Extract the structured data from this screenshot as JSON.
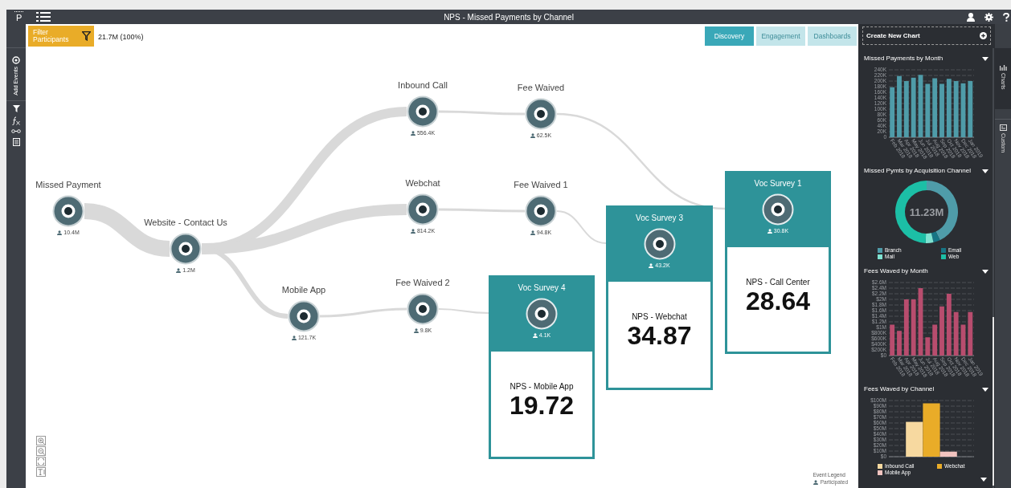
{
  "top_bar": {
    "logo": "P",
    "title": "NPS - Missed Payments by Channel"
  },
  "left_toolbar": {
    "add_events": "Add Events"
  },
  "filter": {
    "label": "Filter Participants",
    "count": "21.7M (100%)"
  },
  "view_tabs": [
    {
      "label": "Discovery",
      "selected": true
    },
    {
      "label": "Engagement",
      "selected": false
    },
    {
      "label": "Dashboards",
      "selected": false
    }
  ],
  "flow": {
    "nodes": [
      {
        "kind": "event",
        "label": "Missed Payment",
        "count": "10.4M"
      },
      {
        "kind": "event",
        "label": "Website - Contact Us",
        "count": "1.2M"
      },
      {
        "kind": "event",
        "label": "Inbound Call",
        "count": "556.4K"
      },
      {
        "kind": "event",
        "label": "Fee Waived",
        "count": "62.5K"
      },
      {
        "kind": "event",
        "label": "Webchat",
        "count": "814.2K"
      },
      {
        "kind": "event",
        "label": "Fee Waived 1",
        "count": "94.8K"
      },
      {
        "kind": "event",
        "label": "Mobile App",
        "count": "121.7K"
      },
      {
        "kind": "event",
        "label": "Fee Waived 2",
        "count": "9.8K"
      },
      {
        "kind": "survey",
        "label": "Voc Survey 4",
        "count": "4.1K",
        "metric": "NPS - Mobile App",
        "score": "19.72"
      },
      {
        "kind": "survey",
        "label": "Voc Survey 3",
        "count": "43.2K",
        "metric": "NPS - Webchat",
        "score": "34.87"
      },
      {
        "kind": "survey",
        "label": "Voc Survey 1",
        "count": "30.8K",
        "metric": "NPS - Call Center",
        "score": "28.64"
      }
    ]
  },
  "event_legend": {
    "title": "Event Legend",
    "item": "Participated"
  },
  "chart_panel": {
    "create_button": "Create New Chart",
    "charts": [
      {
        "kind": "bar",
        "title": "Missed Payments by Month",
        "chart_data": {
          "type": "bar",
          "grid": true,
          "categories": [
            "Feb 2018",
            "Mar 2018",
            "Apr 2018",
            "May 2018",
            "Jun 2018",
            "Jul 2018",
            "Aug 2018",
            "Sep 2018",
            "Oct 2018",
            "Nov 2018",
            "Dec 2018",
            "Jan 2019"
          ],
          "series": [
            {
              "color": "#4f9ca9",
              "values": [
                178000,
                218000,
                200000,
                212000,
                222000,
                190000,
                210000,
                190000,
                208000,
                200000,
                192000,
                200000
              ]
            }
          ],
          "ylim": [
            0,
            240000
          ],
          "yticks": [
            {
              "value": 0,
              "label": "0"
            },
            {
              "value": 20000,
              "label": "20K"
            },
            {
              "value": 40000,
              "label": "40K"
            },
            {
              "value": 60000,
              "label": "60K"
            },
            {
              "value": 80000,
              "label": "80K"
            },
            {
              "value": 100000,
              "label": "100K"
            },
            {
              "value": 120000,
              "label": "120K"
            },
            {
              "value": 140000,
              "label": "140K"
            },
            {
              "value": 160000,
              "label": "160K"
            },
            {
              "value": 180000,
              "label": "180K"
            },
            {
              "value": 200000,
              "label": "200K"
            },
            {
              "value": 220000,
              "label": "220K"
            },
            {
              "value": 240000,
              "label": "240K"
            }
          ]
        }
      },
      {
        "kind": "donut",
        "title": "Missed Pymts by Acquisition Channel",
        "total": "11.23M",
        "legend": [
          {
            "label": "Branch",
            "color": "#4f9ca9"
          },
          {
            "label": "Email",
            "color": "#177585"
          },
          {
            "label": "Mail",
            "color": "#7fe3d2"
          },
          {
            "label": "Web",
            "color": "#1cbfa6"
          }
        ]
      },
      {
        "kind": "bar",
        "title": "Fees Waved by Month",
        "chart_data": {
          "type": "bar",
          "grid": true,
          "categories": [
            "Feb 2018",
            "Mar 2018",
            "Apr 2018",
            "May 2018",
            "Jun 2018",
            "Jul 2018",
            "Aug 2018",
            "Sep 2018",
            "Oct 2018",
            "Nov 2018",
            "Dec 2018",
            "Jan 2019"
          ],
          "series": [
            {
              "color": "#b84d6e",
              "values": [
                1100000,
                880000,
                2000000,
                2000000,
                2400000,
                650000,
                1100000,
                1750000,
                2200000,
                1550000,
                1100000,
                1550000
              ]
            }
          ],
          "ylim": [
            0,
            2600000
          ],
          "yticks": [
            {
              "value": 0,
              "label": "$0"
            },
            {
              "value": 200000,
              "label": "$200K"
            },
            {
              "value": 400000,
              "label": "$400K"
            },
            {
              "value": 600000,
              "label": "$600K"
            },
            {
              "value": 800000,
              "label": "$800K"
            },
            {
              "value": 1000000,
              "label": "$1M"
            },
            {
              "value": 1200000,
              "label": "$1.2M"
            },
            {
              "value": 1400000,
              "label": "$1.4M"
            },
            {
              "value": 1600000,
              "label": "$1.6M"
            },
            {
              "value": 1800000,
              "label": "$1.8M"
            },
            {
              "value": 2000000,
              "label": "$2M"
            },
            {
              "value": 2200000,
              "label": "$2.2M"
            },
            {
              "value": 2400000,
              "label": "$2.4M"
            },
            {
              "value": 2600000,
              "label": "$2.6M"
            }
          ]
        }
      },
      {
        "kind": "bar",
        "title": "Fees Waved by Channel",
        "chart_data": {
          "type": "bar",
          "grid": true,
          "legend": "bottom",
          "series": [
            {
              "name": "Inbound Call",
              "color": "#f7d9a0",
              "values": [
                62000000
              ]
            },
            {
              "name": "Webchat",
              "color": "#e9ac28",
              "values": [
                95000000
              ]
            },
            {
              "name": "Mobile App",
              "color": "#f2c4c0",
              "values": [
                9000000
              ]
            }
          ],
          "ylim": [
            0,
            100000000
          ],
          "yticks": [
            {
              "value": 0,
              "label": "$0"
            },
            {
              "value": 10000000,
              "label": "$10M"
            },
            {
              "value": 20000000,
              "label": "$20M"
            },
            {
              "value": 30000000,
              "label": "$30M"
            },
            {
              "value": 40000000,
              "label": "$40M"
            },
            {
              "value": 50000000,
              "label": "$50M"
            },
            {
              "value": 60000000,
              "label": "$60M"
            },
            {
              "value": 70000000,
              "label": "$70M"
            },
            {
              "value": 80000000,
              "label": "$80M"
            },
            {
              "value": 90000000,
              "label": "$90M"
            },
            {
              "value": 100000000,
              "label": "$100M"
            }
          ]
        }
      }
    ]
  },
  "side_tabs": [
    {
      "label": "Charts",
      "selected": true
    },
    {
      "label": "Custom",
      "selected": false
    }
  ]
}
